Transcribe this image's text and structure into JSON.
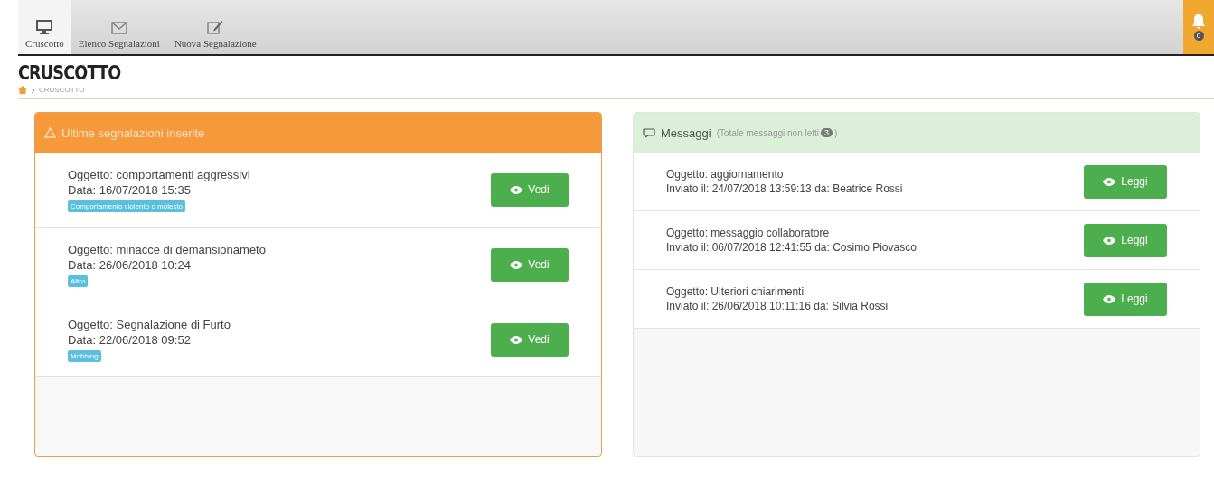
{
  "nav": {
    "tabs": [
      {
        "label": "Cruscotto",
        "kind": "monitor",
        "selected": true
      },
      {
        "label": "Elenco Segnalazioni",
        "kind": "envelope",
        "selected": false
      },
      {
        "label": "Nuova Segnalazione",
        "kind": "edit",
        "selected": false
      }
    ],
    "notifications": {
      "count": "0"
    }
  },
  "page": {
    "title": "CRUSCOTTO",
    "breadcrumb": "CRUSCOTTO"
  },
  "reports": {
    "title": "Ultime segnalazioni inserite",
    "items": [
      {
        "subject": "Oggetto: comportamenti aggressivi",
        "date": "Data: 16/07/2018 15:35",
        "tag": "Comportamento violento o molesto",
        "button": "Vedi"
      },
      {
        "subject": "Oggetto: minacce di demansionameto",
        "date": "Data: 26/06/2018 10:24",
        "tag": "Altro",
        "button": "Vedi"
      },
      {
        "subject": "Oggetto: Segnalazione di Furto",
        "date": "Data: 22/06/2018 09:52",
        "tag": "Mobbing",
        "button": "Vedi"
      }
    ]
  },
  "messages": {
    "title": "Messaggi",
    "subtitle": "(Totale messaggi non letti",
    "unread": "3",
    "subtitle_end": ")",
    "items": [
      {
        "subject": "Oggetto: aggiornamento",
        "sent": "Inviato il: 24/07/2018 13:59:13 da: Beatrice Rossi",
        "button": "Leggi"
      },
      {
        "subject": "Oggetto: messaggio collaboratore",
        "sent": "Inviato il: 06/07/2018 12:41:55 da: Cosimo Piovasco",
        "button": "Leggi"
      },
      {
        "subject": "Oggetto: Ulteriori chiarimenti",
        "sent": "Inviato il: 26/06/2018 10:11:16 da: Silvia Rossi",
        "button": "Leggi"
      }
    ]
  }
}
